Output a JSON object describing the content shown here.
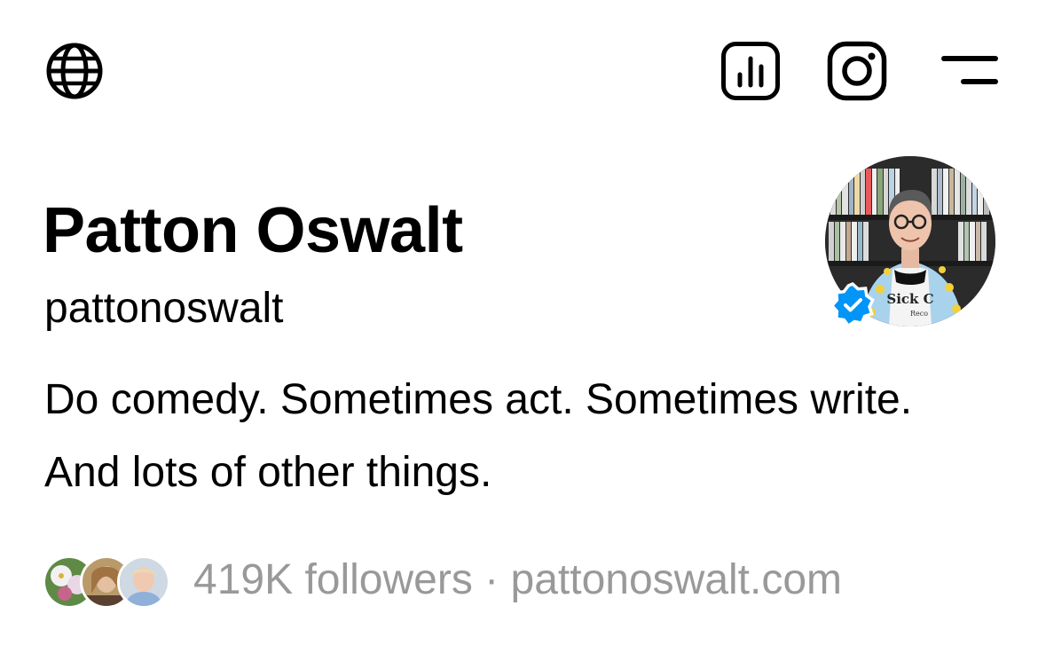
{
  "header": {
    "left_icon": "globe-icon",
    "right_icons": [
      "insights-icon",
      "instagram-icon",
      "menu-icon"
    ]
  },
  "profile": {
    "display_name": "Patton Oswalt",
    "username": "pattonoswalt",
    "bio": "Do comedy. Sometimes act. Sometimes write. And lots of other things.",
    "verified": true,
    "avatar_shirt_text": "Sick C",
    "avatar_shirt_subtext": "Reco"
  },
  "followers": {
    "count_label": "419K followers",
    "separator": " · ",
    "link": "pattonoswalt.com"
  },
  "colors": {
    "text": "#000000",
    "muted": "#999999",
    "verified_badge": "#0095F6",
    "background": "#FFFFFF"
  }
}
